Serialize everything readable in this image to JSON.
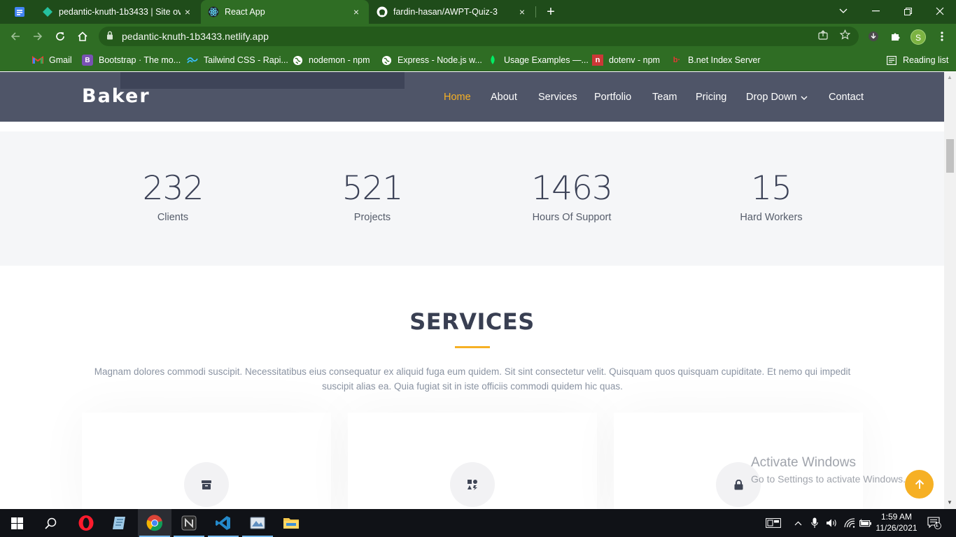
{
  "browser": {
    "tabs": [
      {
        "title": "pedantic-knuth-1b3433 | Site ove",
        "icon": "netlify-icon",
        "active": false
      },
      {
        "title": "React App",
        "icon": "react-icon",
        "active": true
      },
      {
        "title": "fardin-hasan/AWPT-Quiz-3",
        "icon": "github-icon",
        "active": false
      }
    ],
    "close_glyph": "×",
    "new_tab_glyph": "+",
    "url": "pedantic-knuth-1b3433.netlify.app",
    "profile_initial": "S",
    "bookmarks": [
      {
        "label": "Gmail",
        "icon": "gmail-icon"
      },
      {
        "label": "Bootstrap · The mo...",
        "icon": "bootstrap-icon"
      },
      {
        "label": "Tailwind CSS - Rapi...",
        "icon": "tailwind-icon"
      },
      {
        "label": "nodemon - npm",
        "icon": "globe-icon"
      },
      {
        "label": "Express - Node.js w...",
        "icon": "globe-icon"
      },
      {
        "label": "Usage Examples —...",
        "icon": "mongodb-icon"
      },
      {
        "label": "dotenv - npm",
        "icon": "npm-icon"
      },
      {
        "label": "B.net Index Server",
        "icon": "bnet-icon"
      }
    ],
    "reading_list": "Reading list"
  },
  "site": {
    "brand": "Baker",
    "nav": {
      "home": "Home",
      "about": "About",
      "services": "Services",
      "portfolio": "Portfolio",
      "team": "Team",
      "pricing": "Pricing",
      "dropdown": "Drop Down",
      "contact": "Contact"
    },
    "counts": [
      {
        "value": "232",
        "label": "Clients"
      },
      {
        "value": "521",
        "label": "Projects"
      },
      {
        "value": "1463",
        "label": "Hours Of Support"
      },
      {
        "value": "15",
        "label": "Hard Workers"
      }
    ],
    "services": {
      "title": "SERVICES",
      "description": "Magnam dolores commodi suscipit. Necessitatibus eius consequatur ex aliquid fuga eum quidem. Sit sint consectetur velit. Quisquam quos quisquam cupiditate. Et nemo qui impedit suscipit alias ea. Quia fugiat sit in iste officiis commodi quidem hic quas.",
      "cards": [
        {
          "icon": "box-icon"
        },
        {
          "icon": "shapes-icon"
        },
        {
          "icon": "lock-icon"
        }
      ]
    },
    "colors": {
      "accent": "#f6b024",
      "header_bg": "#4f5568",
      "counts_bg": "#f5f6f8"
    }
  },
  "watermark": {
    "line1": "Activate Windows",
    "line2": "Go to Settings to activate Windows."
  },
  "taskbar": {
    "time": "1:59 AM",
    "date": "11/26/2021",
    "notification_count": "1",
    "apps": [
      "windows-start-icon",
      "search-icon",
      "opera-icon",
      "notepad-icon",
      "chrome-icon",
      "notion-icon",
      "vscode-icon",
      "paint-icon",
      "file-explorer-icon"
    ]
  }
}
